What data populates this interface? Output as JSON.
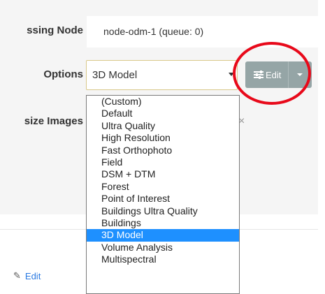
{
  "form": {
    "processing_node_label": "ssing Node",
    "processing_node_value": "node-odm-1 (queue: 0)",
    "options_label": "Options",
    "options_selected": "3D Model",
    "resize_label": "size Images",
    "close_glyph": "×"
  },
  "edit_button": {
    "label": "Edit"
  },
  "dropdown": {
    "options": [
      "(Custom)",
      "Default",
      "Ultra Quality",
      "High Resolution",
      "Fast Orthophoto",
      "Field",
      "DSM + DTM",
      "Forest",
      "Point of Interest",
      "Buildings Ultra Quality",
      "Buildings",
      "3D Model",
      "Volume Analysis",
      "Multispectral"
    ],
    "selected": "3D Model"
  },
  "footer": {
    "edit_link": "Edit"
  },
  "colors": {
    "edit_button": "#95a5a6",
    "highlight_ring": "#e8091a",
    "selected_option": "#1e90ff",
    "link": "#2a7ae2"
  }
}
